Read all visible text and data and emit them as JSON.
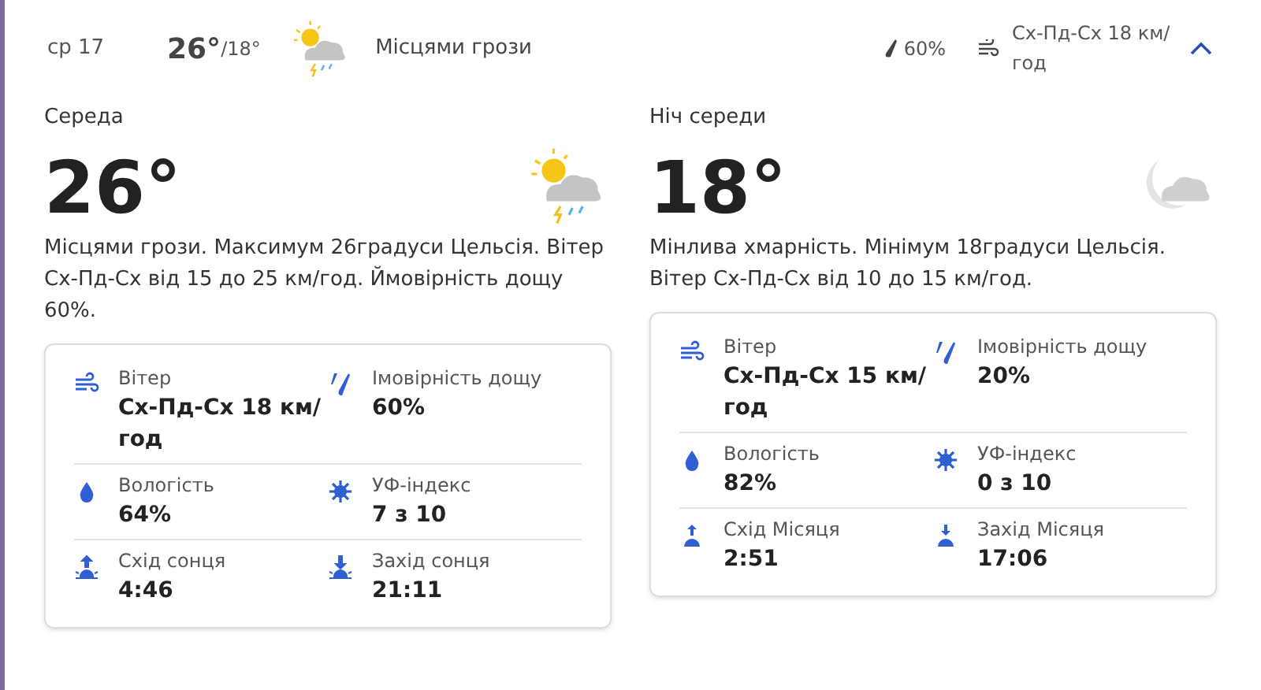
{
  "summary": {
    "day": "ср 17",
    "high": "26°",
    "low": "/18°",
    "kind": "thunderstorm",
    "condition": "Місцями грози",
    "rain_chance": "60%",
    "wind": "Сх-Пд-Сх 18 км/год",
    "expanded": true
  },
  "periods": [
    {
      "title": "Середа",
      "temperature": "26°",
      "kind": "thunderstorm",
      "description": "Місцями грози. Максимум 26градуси Цельсія. Вітер Сх-Пд-Сх від 15 до 25 км/год. Ймовірність дощу 60%.",
      "details": [
        {
          "kind": "wind",
          "label": "Вітер",
          "value": "Сх-Пд-Сх 18 км/год"
        },
        {
          "kind": "rain",
          "label": "Імовірність дощу",
          "value": "60%"
        },
        {
          "kind": "humidity",
          "label": "Вологість",
          "value": "64%"
        },
        {
          "kind": "uv",
          "label": "УФ-індекс",
          "value": "7 з 10"
        },
        {
          "kind": "sunrise",
          "label": "Схід сонця",
          "value": "4:46"
        },
        {
          "kind": "sunset",
          "label": "Захід сонця",
          "value": "21:11"
        }
      ]
    },
    {
      "title": "Ніч середи",
      "temperature": "18°",
      "kind": "cloudy_night",
      "description": "Мінлива хмарність. Мінімум 18градуси Цельсія. Вітер Сх-Пд-Сх від 10 до 15 км/год.",
      "details": [
        {
          "kind": "wind",
          "label": "Вітер",
          "value": "Сх-Пд-Сх 15 км/год"
        },
        {
          "kind": "rain",
          "label": "Імовірність дощу",
          "value": "20%"
        },
        {
          "kind": "humidity",
          "label": "Вологість",
          "value": "82%"
        },
        {
          "kind": "uv",
          "label": "УФ-індекс",
          "value": "0 з 10"
        },
        {
          "kind": "moonrise",
          "label": "Схід Місяця",
          "value": "2:51"
        },
        {
          "kind": "moonset",
          "label": "Захід Місяця",
          "value": "17:06"
        }
      ]
    }
  ]
}
